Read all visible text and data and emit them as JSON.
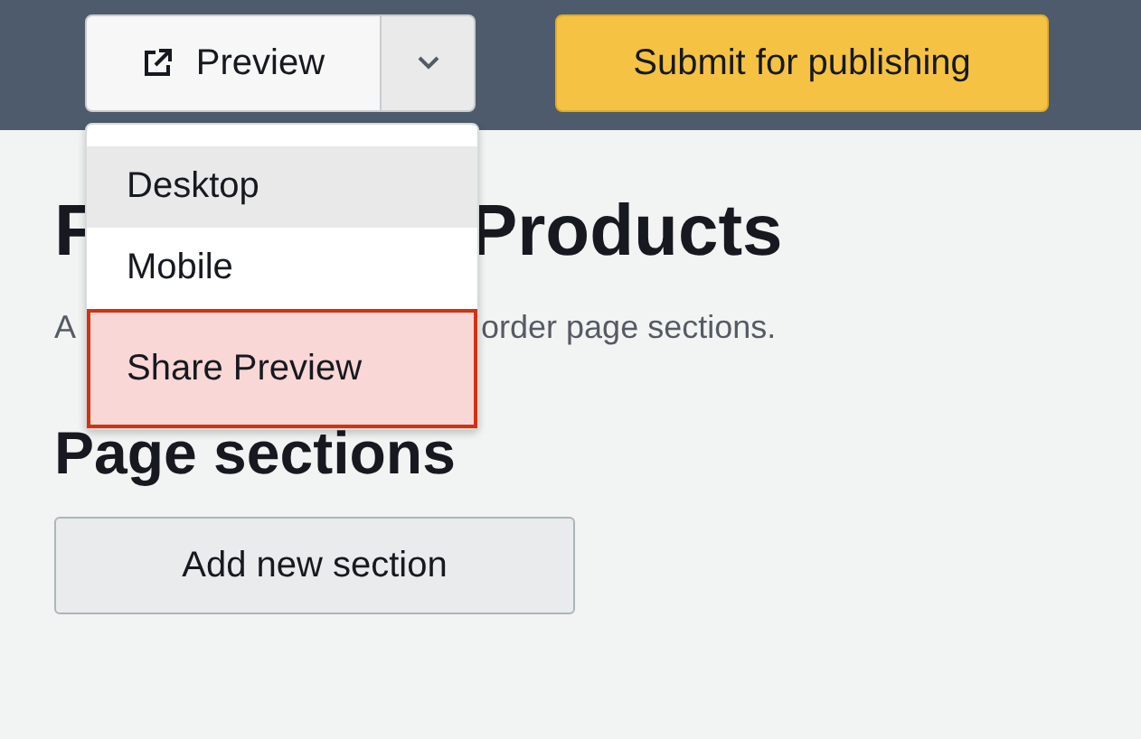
{
  "top_bar": {
    "preview_button": {
      "label": "Preview"
    },
    "submit_button": {
      "label": "Submit for publishing"
    }
  },
  "preview_menu": {
    "items": [
      {
        "label": "Desktop",
        "hovered": true,
        "focused": false
      },
      {
        "label": "Mobile",
        "hovered": false,
        "focused": false
      },
      {
        "label": "Share Preview",
        "hovered": false,
        "focused": true
      }
    ]
  },
  "heading": {
    "left": "F",
    "right": "Products"
  },
  "description": {
    "left": "A",
    "right": "order page sections."
  },
  "sections_heading": "Page sections",
  "add_button": {
    "label": "Add new section"
  }
}
